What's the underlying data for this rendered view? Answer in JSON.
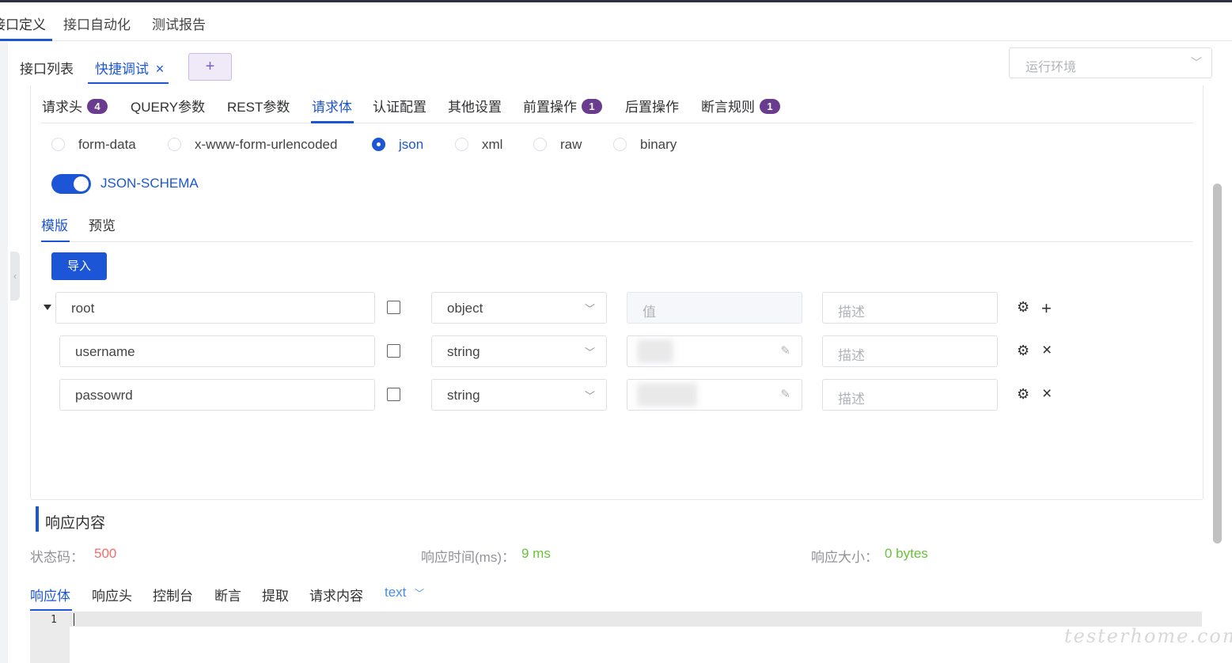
{
  "topnav": {
    "tabs": [
      {
        "label": "接口定义"
      },
      {
        "label": "接口自动化"
      },
      {
        "label": "测试报告"
      }
    ],
    "active_index": 0
  },
  "subtabs": {
    "items": [
      {
        "label": "接口列表"
      },
      {
        "label": "快捷调试"
      }
    ],
    "close_glyph": "×",
    "add_glyph": "+"
  },
  "env_select": {
    "placeholder": "运行环境"
  },
  "panel_tabs": [
    {
      "label": "请求头",
      "badge": "4"
    },
    {
      "label": "QUERY参数"
    },
    {
      "label": "REST参数"
    },
    {
      "label": "请求体",
      "active": true
    },
    {
      "label": "认证配置"
    },
    {
      "label": "其他设置"
    },
    {
      "label": "前置操作",
      "badge": "1"
    },
    {
      "label": "后置操作"
    },
    {
      "label": "断言规则",
      "badge": "1"
    }
  ],
  "body_types": [
    {
      "label": "form-data"
    },
    {
      "label": "x-www-form-urlencoded"
    },
    {
      "label": "json",
      "checked": true
    },
    {
      "label": "xml"
    },
    {
      "label": "raw"
    },
    {
      "label": "binary"
    }
  ],
  "json_schema_toggle": {
    "label": "JSON-SCHEMA",
    "on": true
  },
  "inner_tabs": [
    {
      "label": "模版",
      "active": true
    },
    {
      "label": "预览"
    }
  ],
  "import_button": "导入",
  "schema_rows": [
    {
      "name": "root",
      "type": "object",
      "value_placeholder": "值",
      "desc_placeholder": "描述",
      "action": "+"
    },
    {
      "name": "username",
      "type": "string",
      "value_placeholder": "",
      "desc_placeholder": "描述",
      "action": "×"
    },
    {
      "name": "passowrd",
      "type": "string",
      "value_placeholder": "",
      "desc_placeholder": "描述",
      "action": "×"
    }
  ],
  "response": {
    "title": "响应内容",
    "status_label": "状态码：",
    "status_value": "500",
    "time_label": "响应时间(ms)：",
    "time_value": "9 ms",
    "size_label": "响应大小：",
    "size_value": "0 bytes",
    "tabs": [
      {
        "label": "响应体",
        "active": true
      },
      {
        "label": "响应头"
      },
      {
        "label": "控制台"
      },
      {
        "label": "断言"
      },
      {
        "label": "提取"
      },
      {
        "label": "请求内容"
      }
    ],
    "format": "text",
    "editor_line": "1"
  },
  "watermark": "testerhome.com",
  "colors": {
    "accent": "#1c56d6",
    "badge": "#6a3c8f",
    "error": "#f56c6c",
    "success": "#67c23a"
  }
}
